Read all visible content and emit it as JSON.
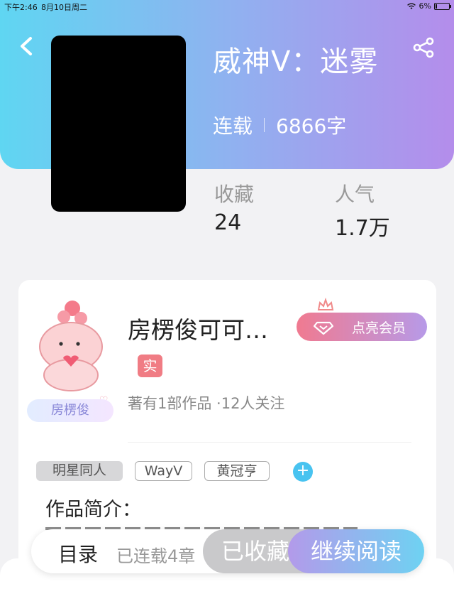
{
  "status_bar": {
    "time": "下午2:46",
    "date": "8月10日周二",
    "battery": "6%"
  },
  "book": {
    "title": "威神V：迷雾",
    "status": "连载",
    "word_count": "6866字"
  },
  "stats": [
    {
      "label": "收藏",
      "value": "24"
    },
    {
      "label": "人气",
      "value": "1.7万"
    }
  ],
  "author": {
    "name": "房楞俊可可…",
    "badge_name": "房楞俊",
    "verified": "实",
    "stats": "著有1部作品 ·12人关注",
    "vip_label": "点亮会员"
  },
  "tags": [
    "明星同人",
    "WayV",
    "黄冠亨"
  ],
  "intro": {
    "title": "作品简介："
  },
  "action_bar": {
    "toc_label": "目录",
    "serial_text": "已连载4章",
    "favorited_label": "已收藏",
    "continue_label": "继续阅读"
  },
  "colors": {
    "header_start": "#5fd6f2",
    "header_end": "#b48deb",
    "tag_add": "#48c3f0",
    "verified": "#f07c84"
  }
}
